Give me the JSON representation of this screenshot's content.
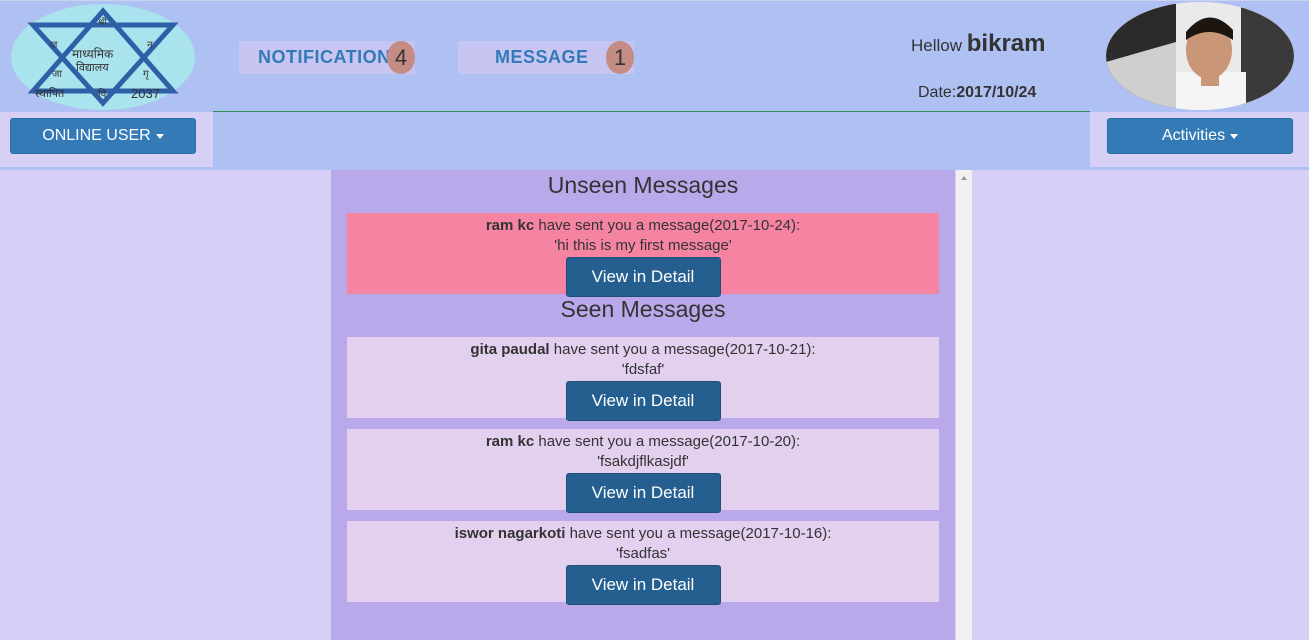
{
  "header": {
    "logo": {
      "top": "श्री",
      "left_top": "ज",
      "right_top": "न",
      "left_bottom": "जा",
      "right_bottom": "गृ",
      "center_line1": "माध्यमिक",
      "center_line2": "विद्यालय",
      "bottom_left": "स्थापित",
      "bottom_mid": "वि",
      "bottom_right": "2037"
    },
    "notification": {
      "label": "NOTIFICATION",
      "count": "4"
    },
    "message": {
      "label": "MESSAGE",
      "count": "1"
    },
    "greeting_prefix": "Hellow",
    "username": "bikram",
    "date_label": "Date:",
    "date_value": "2017/10/24"
  },
  "toolbar": {
    "online_user_label": "ONLINE USER",
    "activities_label": "Activities"
  },
  "sections": {
    "unseen_title": "Unseen Messages",
    "seen_title": "Seen Messages"
  },
  "unseen_messages": [
    {
      "sender": "ram kc",
      "text": " have sent you a message(2017-10-24):",
      "body": "'hi this is my first message'",
      "button": "View in Detail"
    }
  ],
  "seen_messages": [
    {
      "sender": "gita paudal",
      "text": " have sent you a message(2017-10-21):",
      "body": "'fdsfaf'",
      "button": "View in Detail"
    },
    {
      "sender": "ram kc",
      "text": " have sent you a message(2017-10-20):",
      "body": "'fsakdjflkasjdf'",
      "button": "View in Detail"
    },
    {
      "sender": "iswor nagarkoti",
      "text": " have sent you a message(2017-10-16):",
      "body": "'fsadfas'",
      "button": "View in Detail"
    }
  ],
  "colors": {
    "header_bg": "#afc1f3",
    "page_bg": "#d6d0f7",
    "main_bg": "#b9a9ea",
    "unseen_bg": "#f584a3",
    "seen_bg": "#e2d0ee",
    "button": "#245f90",
    "primary": "#337ab7"
  }
}
